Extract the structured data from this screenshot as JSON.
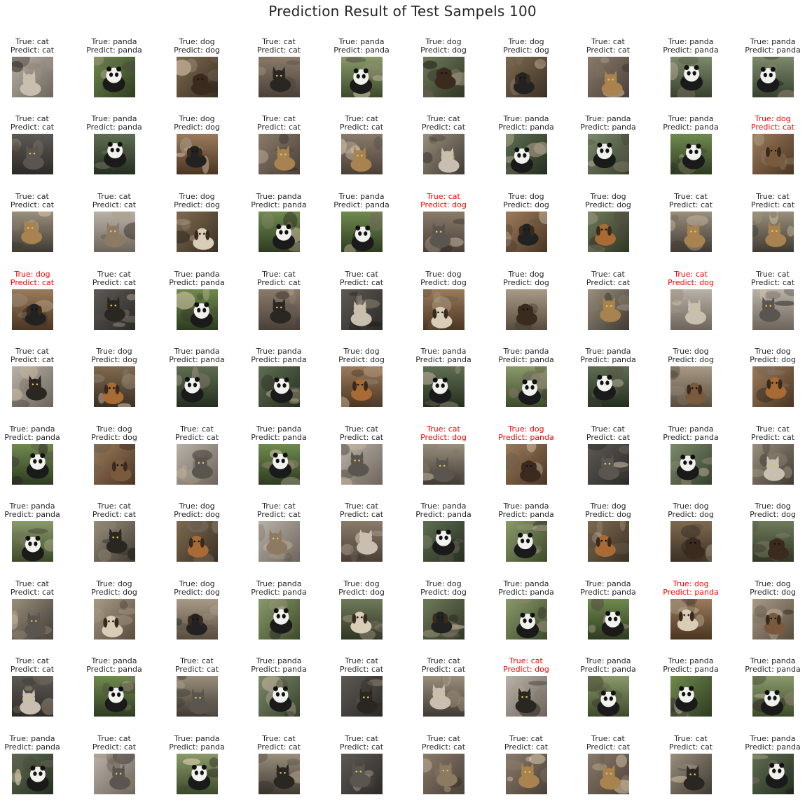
{
  "title": "Prediction Result of Test Sampels 100",
  "labels": {
    "true_prefix": "True: ",
    "predict_prefix": "Predict: "
  },
  "colors": {
    "correct_text": "#262626",
    "wrong_text": "#ff0000"
  },
  "samples": [
    {
      "true": "cat",
      "predict": "cat"
    },
    {
      "true": "panda",
      "predict": "panda"
    },
    {
      "true": "dog",
      "predict": "dog"
    },
    {
      "true": "cat",
      "predict": "cat"
    },
    {
      "true": "panda",
      "predict": "panda"
    },
    {
      "true": "dog",
      "predict": "dog"
    },
    {
      "true": "dog",
      "predict": "dog"
    },
    {
      "true": "cat",
      "predict": "cat"
    },
    {
      "true": "panda",
      "predict": "panda"
    },
    {
      "true": "panda",
      "predict": "panda"
    },
    {
      "true": "cat",
      "predict": "cat"
    },
    {
      "true": "panda",
      "predict": "panda"
    },
    {
      "true": "dog",
      "predict": "dog"
    },
    {
      "true": "cat",
      "predict": "cat"
    },
    {
      "true": "cat",
      "predict": "cat"
    },
    {
      "true": "cat",
      "predict": "cat"
    },
    {
      "true": "panda",
      "predict": "panda"
    },
    {
      "true": "panda",
      "predict": "panda"
    },
    {
      "true": "panda",
      "predict": "panda"
    },
    {
      "true": "dog",
      "predict": "cat"
    },
    {
      "true": "cat",
      "predict": "cat"
    },
    {
      "true": "cat",
      "predict": "cat"
    },
    {
      "true": "dog",
      "predict": "dog"
    },
    {
      "true": "panda",
      "predict": "panda"
    },
    {
      "true": "panda",
      "predict": "panda"
    },
    {
      "true": "cat",
      "predict": "dog"
    },
    {
      "true": "dog",
      "predict": "dog"
    },
    {
      "true": "dog",
      "predict": "dog"
    },
    {
      "true": "cat",
      "predict": "cat"
    },
    {
      "true": "cat",
      "predict": "cat"
    },
    {
      "true": "dog",
      "predict": "cat"
    },
    {
      "true": "cat",
      "predict": "cat"
    },
    {
      "true": "panda",
      "predict": "panda"
    },
    {
      "true": "cat",
      "predict": "cat"
    },
    {
      "true": "cat",
      "predict": "cat"
    },
    {
      "true": "dog",
      "predict": "dog"
    },
    {
      "true": "dog",
      "predict": "dog"
    },
    {
      "true": "cat",
      "predict": "cat"
    },
    {
      "true": "cat",
      "predict": "dog"
    },
    {
      "true": "cat",
      "predict": "cat"
    },
    {
      "true": "cat",
      "predict": "cat"
    },
    {
      "true": "dog",
      "predict": "dog"
    },
    {
      "true": "panda",
      "predict": "panda"
    },
    {
      "true": "panda",
      "predict": "panda"
    },
    {
      "true": "dog",
      "predict": "dog"
    },
    {
      "true": "panda",
      "predict": "panda"
    },
    {
      "true": "panda",
      "predict": "panda"
    },
    {
      "true": "panda",
      "predict": "panda"
    },
    {
      "true": "dog",
      "predict": "dog"
    },
    {
      "true": "dog",
      "predict": "dog"
    },
    {
      "true": "panda",
      "predict": "panda"
    },
    {
      "true": "dog",
      "predict": "dog"
    },
    {
      "true": "cat",
      "predict": "cat"
    },
    {
      "true": "panda",
      "predict": "panda"
    },
    {
      "true": "cat",
      "predict": "cat"
    },
    {
      "true": "cat",
      "predict": "dog"
    },
    {
      "true": "dog",
      "predict": "panda"
    },
    {
      "true": "cat",
      "predict": "cat"
    },
    {
      "true": "panda",
      "predict": "panda"
    },
    {
      "true": "cat",
      "predict": "cat"
    },
    {
      "true": "panda",
      "predict": "panda"
    },
    {
      "true": "cat",
      "predict": "cat"
    },
    {
      "true": "dog",
      "predict": "dog"
    },
    {
      "true": "cat",
      "predict": "cat"
    },
    {
      "true": "cat",
      "predict": "cat"
    },
    {
      "true": "panda",
      "predict": "panda"
    },
    {
      "true": "panda",
      "predict": "panda"
    },
    {
      "true": "dog",
      "predict": "dog"
    },
    {
      "true": "dog",
      "predict": "dog"
    },
    {
      "true": "dog",
      "predict": "dog"
    },
    {
      "true": "cat",
      "predict": "cat"
    },
    {
      "true": "dog",
      "predict": "dog"
    },
    {
      "true": "dog",
      "predict": "dog"
    },
    {
      "true": "panda",
      "predict": "panda"
    },
    {
      "true": "dog",
      "predict": "dog"
    },
    {
      "true": "dog",
      "predict": "dog"
    },
    {
      "true": "panda",
      "predict": "panda"
    },
    {
      "true": "panda",
      "predict": "panda"
    },
    {
      "true": "dog",
      "predict": "panda"
    },
    {
      "true": "dog",
      "predict": "dog"
    },
    {
      "true": "cat",
      "predict": "cat"
    },
    {
      "true": "panda",
      "predict": "panda"
    },
    {
      "true": "cat",
      "predict": "cat"
    },
    {
      "true": "panda",
      "predict": "panda"
    },
    {
      "true": "cat",
      "predict": "cat"
    },
    {
      "true": "cat",
      "predict": "cat"
    },
    {
      "true": "cat",
      "predict": "dog"
    },
    {
      "true": "panda",
      "predict": "panda"
    },
    {
      "true": "panda",
      "predict": "panda"
    },
    {
      "true": "panda",
      "predict": "panda"
    },
    {
      "true": "panda",
      "predict": "panda"
    },
    {
      "true": "cat",
      "predict": "cat"
    },
    {
      "true": "panda",
      "predict": "panda"
    },
    {
      "true": "cat",
      "predict": "cat"
    },
    {
      "true": "cat",
      "predict": "cat"
    },
    {
      "true": "cat",
      "predict": "cat"
    },
    {
      "true": "cat",
      "predict": "cat"
    },
    {
      "true": "cat",
      "predict": "cat"
    },
    {
      "true": "cat",
      "predict": "cat"
    },
    {
      "true": "panda",
      "predict": "panda"
    }
  ]
}
